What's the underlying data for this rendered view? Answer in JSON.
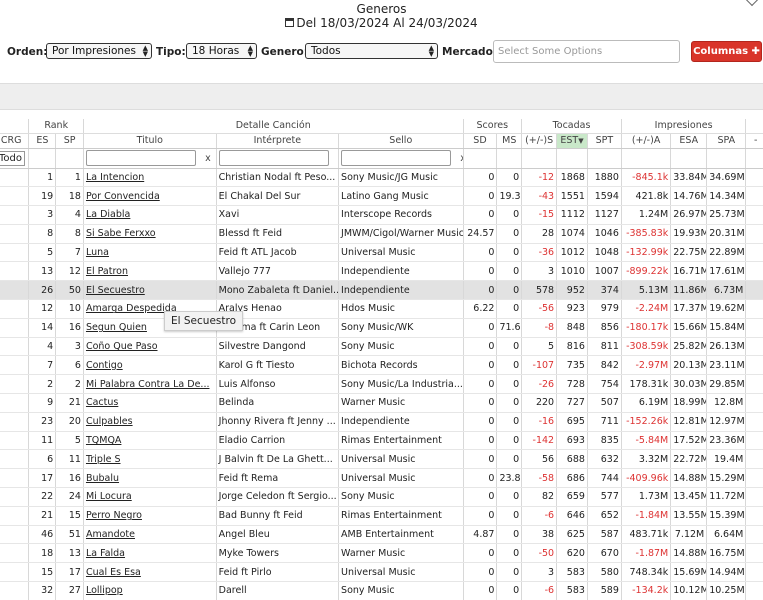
{
  "page": {
    "title": "Generos",
    "date_range": "Del 18/03/2024 Al 24/03/2024"
  },
  "filters": {
    "orden_label": "Orden:",
    "orden_value": "Por Impresiones",
    "tipo_label": "Tipo:",
    "tipo_value": "18 Horas",
    "genero_label": "Genero:",
    "genero_value": "Todos",
    "mercado_label": "Mercado:",
    "mercado_placeholder": "Select Some Options",
    "columns_button": "Columnas"
  },
  "table": {
    "groups": {
      "rank": "Rank",
      "detalle": "Detalle Canción",
      "scores": "Scores",
      "tocadas": "Tocadas",
      "impresiones": "Impresiones"
    },
    "columns": {
      "crg": "CRG",
      "es": "ES",
      "sp": "SP",
      "titulo": "Titulo",
      "interprete": "Intérprete",
      "sello": "Sello",
      "sd": "SD",
      "ms": "MS",
      "tdelta": "(+/-)S",
      "est": "EST",
      "spt": "SPT",
      "idelta": "(+/-)A",
      "esa": "ESA",
      "spa": "SPA",
      "last": "-"
    },
    "filter_all": "Todo",
    "clear": "x",
    "rows": [
      {
        "es": "1",
        "sp": "1",
        "titulo": "La Intencion",
        "interprete": "Christian Nodal ft Peso...",
        "sello": "Sony Music/JG Music",
        "sd": "0",
        "ms": "0",
        "td": "-12",
        "est": "1868",
        "spt": "1880",
        "id": "-845.1k",
        "esa": "33.84M",
        "spa": "34.69M"
      },
      {
        "es": "19",
        "sp": "18",
        "titulo": "Por Convencida",
        "interprete": "El Chakal Del Sur",
        "sello": "Latino Gang Music",
        "sd": "0",
        "ms": "19.35",
        "td": "-43",
        "est": "1551",
        "spt": "1594",
        "id": "421.8k",
        "esa": "14.76M",
        "spa": "14.34M"
      },
      {
        "es": "3",
        "sp": "4",
        "titulo": "La Diabla",
        "interprete": "Xavi",
        "sello": "Interscope Records",
        "sd": "0",
        "ms": "0",
        "td": "-15",
        "est": "1112",
        "spt": "1127",
        "id": "1.24M",
        "esa": "26.97M",
        "spa": "25.73M"
      },
      {
        "es": "8",
        "sp": "8",
        "titulo": "Si Sabe Ferxxo",
        "interprete": "Blessd ft Feid",
        "sello": "JMWM/Cigol/Warner Music",
        "sd": "24.57",
        "ms": "0",
        "td": "28",
        "est": "1074",
        "spt": "1046",
        "id": "-385.83k",
        "esa": "19.93M",
        "spa": "20.31M"
      },
      {
        "es": "5",
        "sp": "7",
        "titulo": "Luna",
        "interprete": "Feid ft ATL Jacob",
        "sello": "Universal Music",
        "sd": "0",
        "ms": "0",
        "td": "-36",
        "est": "1012",
        "spt": "1048",
        "id": "-132.99k",
        "esa": "22.75M",
        "spa": "22.89M"
      },
      {
        "es": "13",
        "sp": "12",
        "titulo": "El Patron",
        "interprete": "Vallejo 777",
        "sello": "Independiente",
        "sd": "0",
        "ms": "0",
        "td": "3",
        "est": "1010",
        "spt": "1007",
        "id": "-899.22k",
        "esa": "16.71M",
        "spa": "17.61M"
      },
      {
        "es": "26",
        "sp": "50",
        "titulo": "El Secuestro",
        "interprete": "Mono Zabaleta ft Daniel...",
        "sello": "Independiente",
        "sd": "0",
        "ms": "0",
        "td": "578",
        "est": "952",
        "spt": "374",
        "id": "5.13M",
        "esa": "11.86M",
        "spa": "6.73M"
      },
      {
        "es": "12",
        "sp": "10",
        "titulo": "Amarga Despedida",
        "interprete": "Aralys Henao",
        "sello": "Hdos Music",
        "sd": "6.22",
        "ms": "0",
        "td": "-56",
        "est": "923",
        "spt": "979",
        "id": "-2.24M",
        "esa": "17.37M",
        "spa": "19.62M"
      },
      {
        "es": "14",
        "sp": "16",
        "titulo": "Segun Quien",
        "interprete": "Maluma ft Carin Leon",
        "sello": "Sony Music/WK",
        "sd": "0",
        "ms": "71.61",
        "td": "-8",
        "est": "848",
        "spt": "856",
        "id": "-180.17k",
        "esa": "15.66M",
        "spa": "15.84M"
      },
      {
        "es": "4",
        "sp": "3",
        "titulo": "Coño Que Paso",
        "interprete": "Silvestre Dangond",
        "sello": "Sony Music",
        "sd": "0",
        "ms": "0",
        "td": "5",
        "est": "816",
        "spt": "811",
        "id": "-308.59k",
        "esa": "25.82M",
        "spa": "26.13M"
      },
      {
        "es": "7",
        "sp": "6",
        "titulo": "Contigo",
        "interprete": "Karol G ft Tiesto",
        "sello": "Bichota Records",
        "sd": "0",
        "ms": "0",
        "td": "-107",
        "est": "735",
        "spt": "842",
        "id": "-2.97M",
        "esa": "20.13M",
        "spa": "23.11M"
      },
      {
        "es": "2",
        "sp": "2",
        "titulo": "Mi Palabra Contra La De...",
        "interprete": "Luis Alfonso",
        "sello": "Sony Music/La Industria...",
        "sd": "0",
        "ms": "0",
        "td": "-26",
        "est": "728",
        "spt": "754",
        "id": "178.31k",
        "esa": "30.03M",
        "spa": "29.85M"
      },
      {
        "es": "9",
        "sp": "21",
        "titulo": "Cactus",
        "interprete": "Belinda",
        "sello": "Warner Music",
        "sd": "0",
        "ms": "0",
        "td": "220",
        "est": "727",
        "spt": "507",
        "id": "6.19M",
        "esa": "18.99M",
        "spa": "12.8M"
      },
      {
        "es": "23",
        "sp": "20",
        "titulo": "Culpables",
        "interprete": "Jhonny Rivera ft Jenny ...",
        "sello": "Independiente",
        "sd": "0",
        "ms": "0",
        "td": "-16",
        "est": "695",
        "spt": "711",
        "id": "-152.26k",
        "esa": "12.81M",
        "spa": "12.97M"
      },
      {
        "es": "11",
        "sp": "5",
        "titulo": "TQMQA",
        "interprete": "Eladio Carrion",
        "sello": "Rimas Entertainment",
        "sd": "0",
        "ms": "0",
        "td": "-142",
        "est": "693",
        "spt": "835",
        "id": "-5.84M",
        "esa": "17.52M",
        "spa": "23.36M"
      },
      {
        "es": "6",
        "sp": "11",
        "titulo": "Triple S",
        "interprete": "J Balvin ft De La Ghett...",
        "sello": "Universal Music",
        "sd": "0",
        "ms": "0",
        "td": "56",
        "est": "688",
        "spt": "632",
        "id": "3.32M",
        "esa": "22.72M",
        "spa": "19.4M"
      },
      {
        "es": "17",
        "sp": "16",
        "titulo": "Bubalu",
        "interprete": "Feid ft Rema",
        "sello": "Universal Music",
        "sd": "0",
        "ms": "23.87",
        "td": "-58",
        "est": "686",
        "spt": "744",
        "id": "-409.96k",
        "esa": "14.88M",
        "spa": "15.29M"
      },
      {
        "es": "22",
        "sp": "24",
        "titulo": "Mi Locura",
        "interprete": "Jorge Celedon ft Sergio...",
        "sello": "Sony Music",
        "sd": "0",
        "ms": "0",
        "td": "82",
        "est": "659",
        "spt": "577",
        "id": "1.73M",
        "esa": "13.45M",
        "spa": "11.72M"
      },
      {
        "es": "21",
        "sp": "15",
        "titulo": "Perro Negro",
        "interprete": "Bad Bunny ft Feid",
        "sello": "Rimas Entertainment",
        "sd": "0",
        "ms": "0",
        "td": "-6",
        "est": "646",
        "spt": "652",
        "id": "-1.84M",
        "esa": "13.55M",
        "spa": "15.39M"
      },
      {
        "es": "46",
        "sp": "51",
        "titulo": "Amandote",
        "interprete": "Angel Bleu",
        "sello": "AMB Entertainment",
        "sd": "4.87",
        "ms": "0",
        "td": "38",
        "est": "625",
        "spt": "587",
        "id": "483.71k",
        "esa": "7.12M",
        "spa": "6.64M"
      },
      {
        "es": "18",
        "sp": "13",
        "titulo": "La Falda",
        "interprete": "Myke Towers",
        "sello": "Warner Music",
        "sd": "0",
        "ms": "0",
        "td": "-50",
        "est": "620",
        "spt": "670",
        "id": "-1.87M",
        "esa": "14.88M",
        "spa": "16.75M"
      },
      {
        "es": "15",
        "sp": "17",
        "titulo": "Cual Es Esa",
        "interprete": "Feid ft Pirlo",
        "sello": "Universal Music",
        "sd": "0",
        "ms": "0",
        "td": "3",
        "est": "583",
        "spt": "580",
        "id": "748.34k",
        "esa": "15.69M",
        "spa": "14.94M"
      },
      {
        "es": "32",
        "sp": "27",
        "titulo": "Lollipop",
        "interprete": "Darell",
        "sello": "Sony Music",
        "sd": "0",
        "ms": "0",
        "td": "-6",
        "est": "583",
        "spt": "589",
        "id": "-134.2k",
        "esa": "10.12M",
        "spa": "10.25M"
      }
    ]
  },
  "tooltip": "El Secuestro",
  "colors": {
    "negative": "#d33333",
    "button": "#d9352a",
    "sorted_header": "#c9e8c9",
    "highlight_row": "#e2e2e2"
  }
}
